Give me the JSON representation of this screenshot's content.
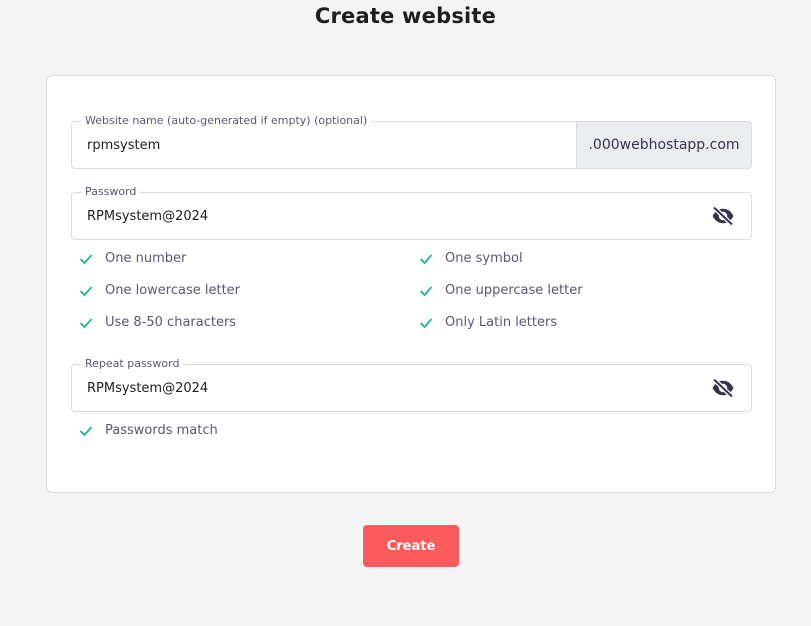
{
  "page": {
    "title": "Create website"
  },
  "website_name": {
    "label": "Website name (auto-generated if empty) (optional)",
    "value": "rpmsystem",
    "suffix": ".000webhostapp.com"
  },
  "password": {
    "label": "Password",
    "value": "RPMsystem@2024",
    "toggle_icon": "eye-slash-icon"
  },
  "requirements": [
    {
      "label": "One number",
      "met": true
    },
    {
      "label": "One symbol",
      "met": true
    },
    {
      "label": "One lowercase letter",
      "met": true
    },
    {
      "label": "One uppercase letter",
      "met": true
    },
    {
      "label": "Use 8-50 characters",
      "met": true
    },
    {
      "label": "Only Latin letters",
      "met": true
    }
  ],
  "repeat_password": {
    "label": "Repeat password",
    "value": "RPMsystem@2024",
    "toggle_icon": "eye-slash-icon",
    "match_label": "Passwords match"
  },
  "actions": {
    "create_label": "Create"
  },
  "colors": {
    "accent": "#fc5b5e",
    "check": "#00b090",
    "background": "#f4f4f4"
  }
}
